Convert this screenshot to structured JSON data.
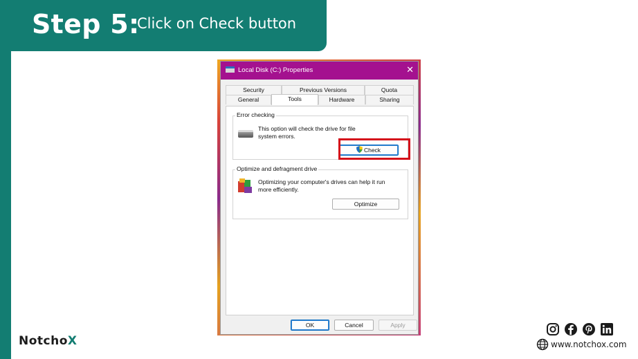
{
  "header": {
    "step_label": "Step 5:",
    "step_text": "Click on Check button"
  },
  "colors": {
    "brand_teal": "#137d72",
    "titlebar": "#a4118f",
    "highlight": "#d40f1a"
  },
  "dialog": {
    "title": "Local Disk (C:) Properties",
    "close_glyph": "✕",
    "tabs_top": [
      "Security",
      "Previous Versions",
      "Quota"
    ],
    "tabs_bottom": [
      "General",
      "Tools",
      "Hardware",
      "Sharing"
    ],
    "active_tab": "Tools",
    "error_checking": {
      "title": "Error checking",
      "description_line1": "This option will check the drive for file",
      "description_line2": "system errors.",
      "button": "Check",
      "icon": "hard-drive-icon"
    },
    "optimize": {
      "title": "Optimize and defragment drive",
      "description_line1": "Optimizing your computer's drives can help it run",
      "description_line2": "more efficiently.",
      "button": "Optimize",
      "icon": "defrag-icon"
    },
    "footer_buttons": {
      "ok": "OK",
      "cancel": "Cancel",
      "apply": "Apply"
    }
  },
  "footer": {
    "logo_main": "Notcho",
    "logo_x": "X",
    "website": "www.notchox.com",
    "social_icons": [
      "instagram-icon",
      "facebook-icon",
      "pinterest-icon",
      "linkedin-icon"
    ]
  }
}
